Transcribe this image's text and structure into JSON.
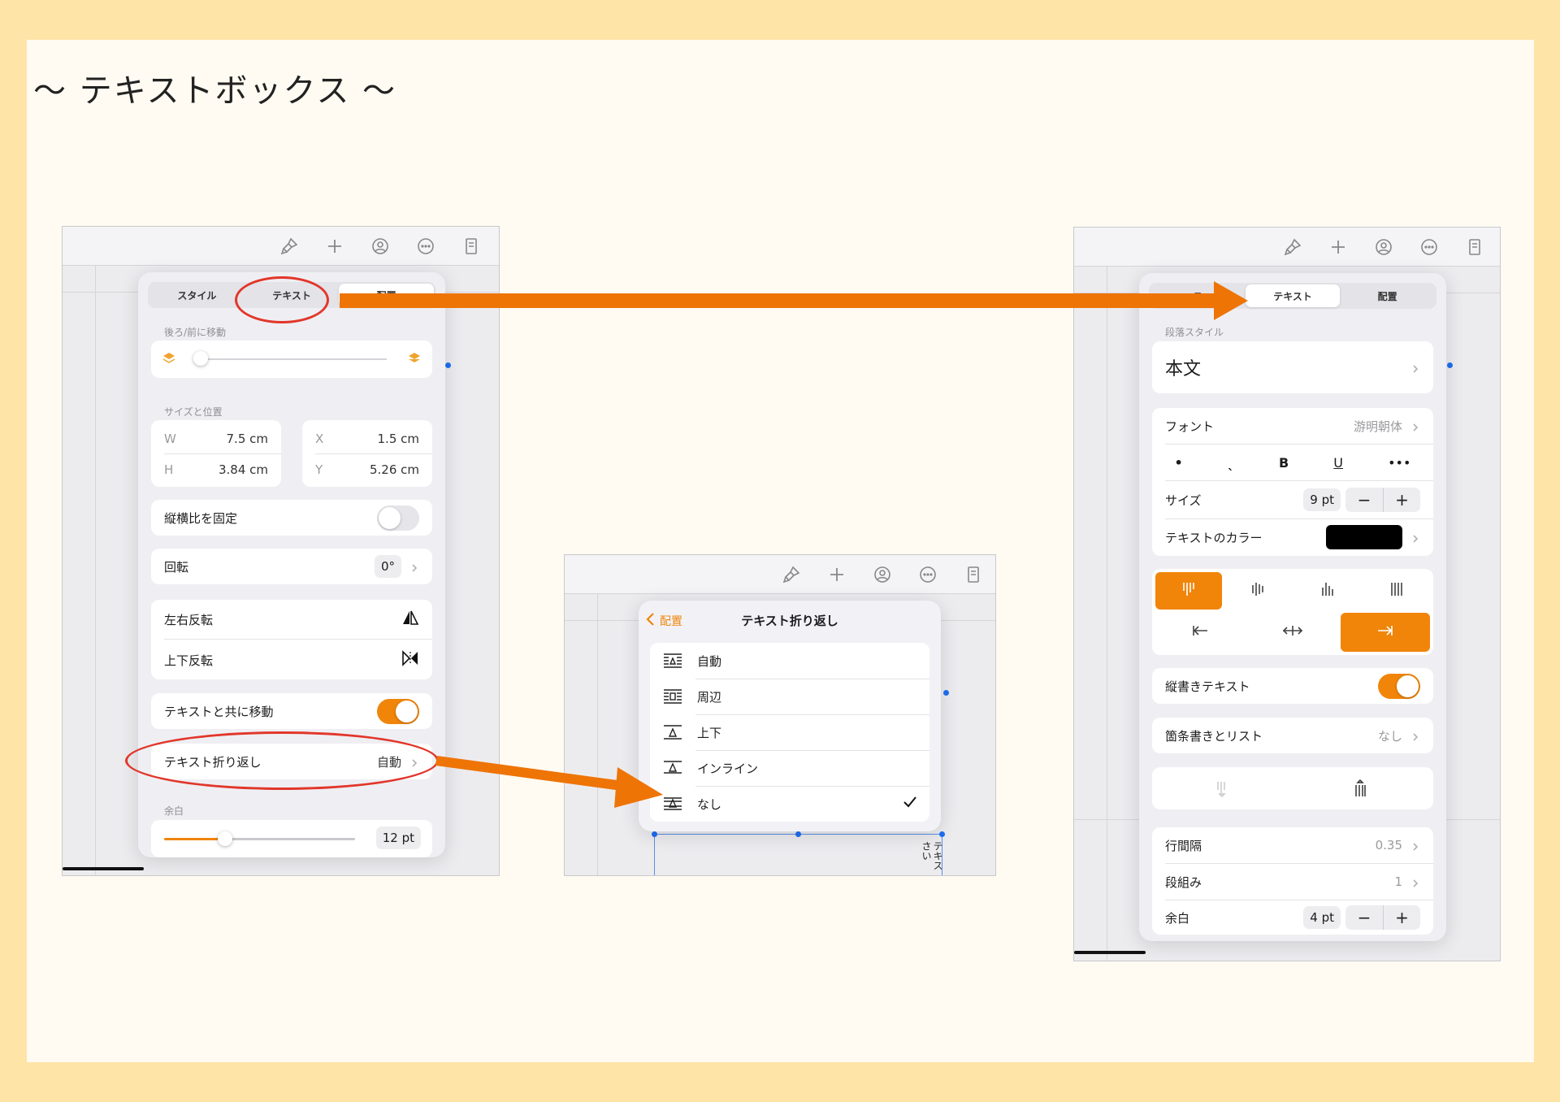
{
  "slide_title": "〜 テキストボックス 〜",
  "colors": {
    "accent": "#f0850a",
    "annotation": "#e2362a",
    "arrow": "#ee7406"
  },
  "toolbar_icons": [
    "paintbrush-icon",
    "plus-icon",
    "collaborate-icon",
    "more-icon",
    "document-icon"
  ],
  "left_panel": {
    "tabs": [
      "スタイル",
      "テキスト",
      "配置"
    ],
    "active_tab": 2,
    "move_label": "後ろ/前に移動",
    "size_position_label": "サイズと位置",
    "w_label": "W",
    "w_value": "7.5 cm",
    "h_label": "H",
    "h_value": "3.84 cm",
    "x_label": "X",
    "x_value": "1.5 cm",
    "y_label": "Y",
    "y_value": "5.26 cm",
    "lock_aspect_label": "縦横比を固定",
    "rotate_label": "回転",
    "rotate_value": "0°",
    "flip_h_label": "左右反転",
    "flip_v_label": "上下反転",
    "move_with_text_label": "テキストと共に移動",
    "text_wrap_label": "テキスト折り返し",
    "text_wrap_value": "自動",
    "margin_label": "余白",
    "margin_value": "12 pt",
    "margin_fraction": 0.32,
    "move_slider_fraction": 0.0
  },
  "middle_panel": {
    "back_label": "配置",
    "title": "テキスト折り返し",
    "options": [
      "自動",
      "周辺",
      "上下",
      "インライン",
      "なし"
    ],
    "selected_index": 4,
    "doc_text_1": "テキス",
    "doc_text_2": "さい"
  },
  "right_panel": {
    "tabs": [
      "ス",
      "テキスト",
      "配置"
    ],
    "active_tab": 1,
    "paragraph_style_label": "段落スタイル",
    "paragraph_style_value": "本文",
    "font_label": "フォント",
    "font_value": "游明朝体",
    "format_buttons": [
      "•",
      "ˎ",
      "B",
      "U",
      "•••"
    ],
    "size_label": "サイズ",
    "size_value": "9 pt",
    "text_color_label": "テキストのカラー",
    "text_color": "#000000",
    "vertical_text_label": "縦書きテキスト",
    "bullets_label": "箇条書きとリスト",
    "bullets_value": "なし",
    "line_spacing_label": "行間隔",
    "line_spacing_value": "0.35",
    "columns_label": "段組み",
    "columns_value": "1",
    "margin_label": "余白",
    "margin_value": "4 pt"
  }
}
